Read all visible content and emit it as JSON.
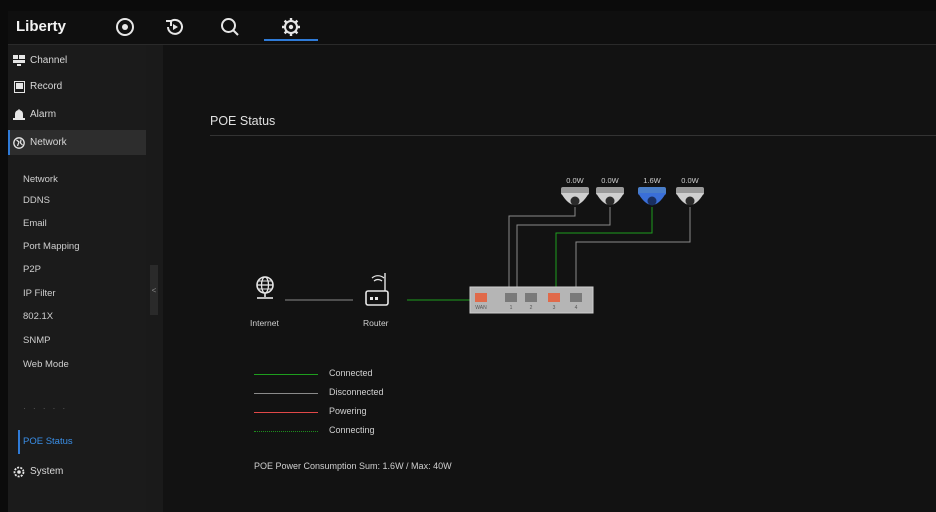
{
  "app": {
    "brand": "Liberty"
  },
  "topnav": [
    {
      "name": "live-view-icon"
    },
    {
      "name": "playback-icon"
    },
    {
      "name": "search-icon"
    },
    {
      "name": "settings-icon",
      "active": true
    }
  ],
  "sidebar": {
    "menu": [
      {
        "label": "Channel",
        "icon": "channel-icon"
      },
      {
        "label": "Record",
        "icon": "record-icon"
      },
      {
        "label": "Alarm",
        "icon": "alarm-icon"
      },
      {
        "label": "Network",
        "icon": "network-icon",
        "active": true
      }
    ],
    "submenu": [
      "Network",
      "DDNS",
      "Email",
      "Port Mapping",
      "P2P",
      "IP Filter",
      "802.1X",
      "SNMP",
      "Web Mode",
      "POE Status"
    ],
    "selected": "POE Status",
    "system": {
      "label": "System",
      "icon": "system-icon"
    }
  },
  "page": {
    "title": "POE Status"
  },
  "diagram": {
    "internet_label": "Internet",
    "router_label": "Router",
    "cameras": [
      {
        "watt": "0.0W",
        "state": "disconnected"
      },
      {
        "watt": "0.0W",
        "state": "disconnected"
      },
      {
        "watt": "1.6W",
        "state": "powering"
      },
      {
        "watt": "0.0W",
        "state": "disconnected"
      }
    ]
  },
  "legend": [
    {
      "label": "Connected",
      "color": "#1e9e1e",
      "style": "solid"
    },
    {
      "label": "Disconnected",
      "color": "#8a8a8a",
      "style": "solid"
    },
    {
      "label": "Powering",
      "color": "#e04848",
      "style": "solid"
    },
    {
      "label": "Connecting",
      "color": "#1e8e1e",
      "style": "dotted"
    }
  ],
  "summary": "POE Power Consumption Sum: 1.6W / Max: 40W",
  "colors": {
    "accent": "#2f7bd8",
    "connected": "#1e9e1e",
    "disconnected": "#8a8a8a",
    "powering": "#e04848",
    "cam_active": "#3a6fd8"
  }
}
